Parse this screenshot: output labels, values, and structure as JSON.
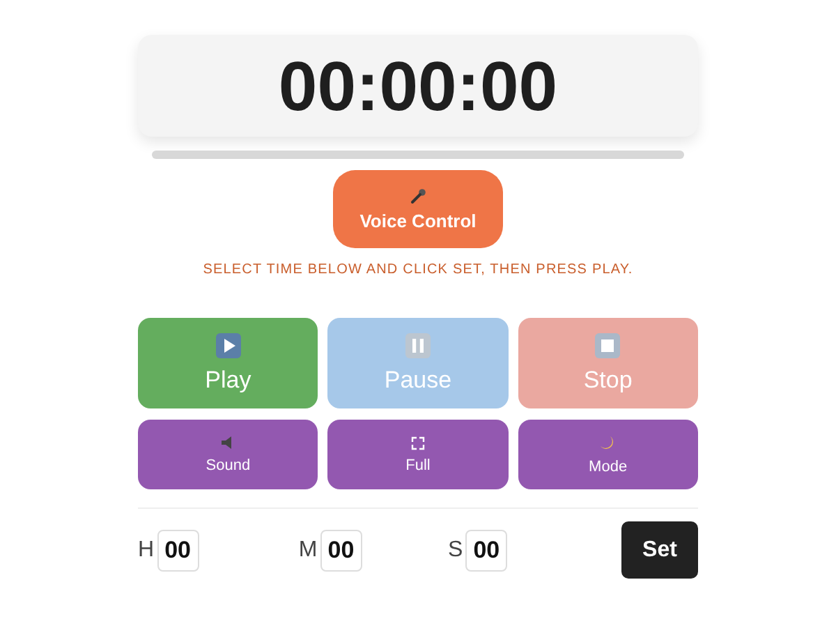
{
  "timer": {
    "display": "00:00:00"
  },
  "voice_button": {
    "label": "Voice Control"
  },
  "instruction": "SELECT TIME BELOW AND CLICK SET, THEN PRESS PLAY.",
  "controls": [
    {
      "kind": "main",
      "label": "Play",
      "color": "#64ad5e"
    },
    {
      "kind": "main",
      "label": "Pause",
      "color": "#a6c8e9"
    },
    {
      "kind": "main",
      "label": "Stop",
      "color": "#eaa8a0"
    },
    {
      "kind": "small",
      "label": "Sound",
      "color": "#9358b0"
    },
    {
      "kind": "small",
      "label": "Full",
      "color": "#9358b0"
    },
    {
      "kind": "small",
      "label": "Mode",
      "color": "#9358b0"
    }
  ],
  "time_fields": [
    {
      "label": "H",
      "value": "00"
    },
    {
      "label": "M",
      "value": "00"
    },
    {
      "label": "S",
      "value": "00"
    }
  ],
  "set_button": {
    "label": "Set"
  }
}
